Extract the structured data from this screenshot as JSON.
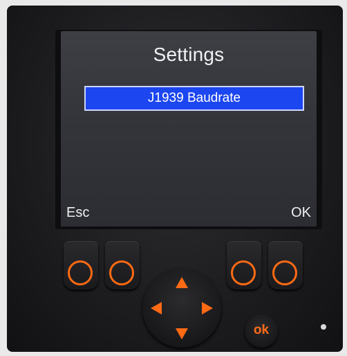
{
  "screen": {
    "title": "Settings",
    "selected_item": "J1939 Baudrate",
    "softkey_left": "Esc",
    "softkey_right": "OK"
  },
  "keypad": {
    "ok_label": "ok",
    "softkeys": [
      "softkey-1",
      "softkey-2",
      "softkey-3",
      "softkey-4"
    ]
  },
  "colors": {
    "accent": "#ff6a14",
    "selection": "#1c46f0",
    "screen_bg": "#33353a"
  },
  "icons": {
    "up": "arrow-up-icon",
    "down": "arrow-down-icon",
    "left": "arrow-left-icon",
    "right": "arrow-right-icon",
    "softkey": "circle-icon"
  }
}
